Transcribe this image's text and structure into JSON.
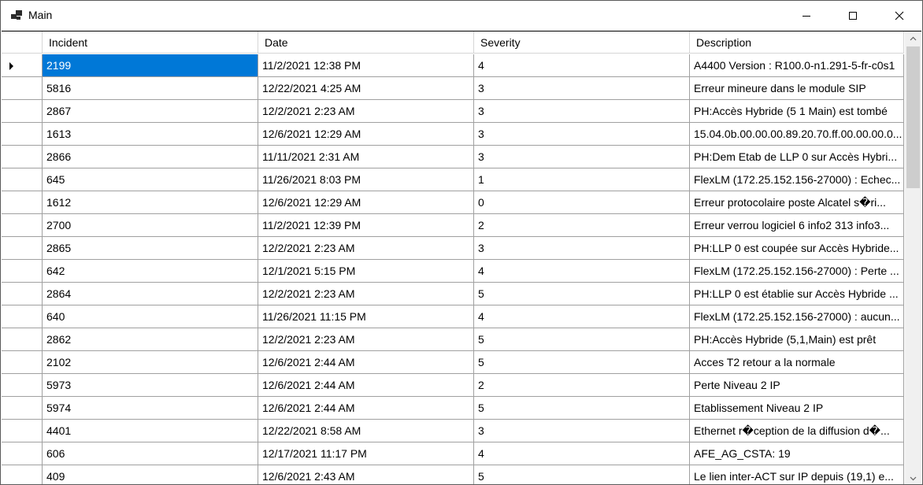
{
  "window": {
    "title": "Main"
  },
  "grid": {
    "columns": [
      "Incident",
      "Date",
      "Severity",
      "Description"
    ],
    "selected_row": 0,
    "selected_col": 0,
    "rows": [
      [
        "2199",
        "11/2/2021 12:38 PM",
        "4",
        "A4400 Version : R100.0-n1.291-5-fr-c0s1"
      ],
      [
        "5816",
        "12/22/2021 4:25 AM",
        "3",
        "Erreur mineure dans le module SIP"
      ],
      [
        "2867",
        "12/2/2021 2:23 AM",
        "3",
        "PH:Accès Hybride (5 1 Main) est tombé"
      ],
      [
        "1613",
        "12/6/2021 12:29 AM",
        "3",
        "15.04.0b.00.00.00.89.20.70.ff.00.00.00.0..."
      ],
      [
        "2866",
        "11/11/2021 2:31 AM",
        "3",
        "PH:Dem Etab de LLP 0 sur Accès Hybri..."
      ],
      [
        "645",
        "11/26/2021 8:03 PM",
        "1",
        "FlexLM (172.25.152.156-27000) : Echec..."
      ],
      [
        "1612",
        "12/6/2021 12:29 AM",
        "0",
        "Erreur protocolaire poste Alcatel s�ri..."
      ],
      [
        "2700",
        "11/2/2021 12:39 PM",
        "2",
        "Erreur verrou logiciel 6 info2 313 info3..."
      ],
      [
        "2865",
        "12/2/2021 2:23 AM",
        "3",
        "PH:LLP 0 est coupée sur Accès Hybride..."
      ],
      [
        "642",
        "12/1/2021 5:15 PM",
        "4",
        "FlexLM (172.25.152.156-27000) : Perte ..."
      ],
      [
        "2864",
        "12/2/2021 2:23 AM",
        "5",
        "PH:LLP 0 est établie sur Accès Hybride ..."
      ],
      [
        "640",
        "11/26/2021 11:15 PM",
        "4",
        "FlexLM (172.25.152.156-27000) : aucun..."
      ],
      [
        "2862",
        "12/2/2021 2:23 AM",
        "5",
        "PH:Accès Hybride (5,1,Main) est prêt"
      ],
      [
        "2102",
        "12/6/2021 2:44 AM",
        "5",
        "Acces T2 retour a la normale"
      ],
      [
        "5973",
        "12/6/2021 2:44 AM",
        "2",
        "Perte Niveau 2 IP"
      ],
      [
        "5974",
        "12/6/2021 2:44 AM",
        "5",
        "Etablissement Niveau 2 IP"
      ],
      [
        "4401",
        "12/22/2021 8:58 AM",
        "3",
        "Ethernet r�ception de la diffusion d�..."
      ],
      [
        "606",
        "12/17/2021 11:17 PM",
        "4",
        "AFE_AG_CSTA: 19"
      ],
      [
        "409",
        "12/6/2021 2:43 AM",
        "5",
        "Le lien inter-ACT sur IP depuis (19,1) e..."
      ]
    ]
  },
  "colors": {
    "selection": "#0078d7",
    "grid_line": "#a0a0a0",
    "scrollbar_track": "#f0f0f0",
    "scrollbar_thumb": "#cdcdcd"
  },
  "icons": {
    "app": "windows-app-icon",
    "minimize": "minimize-icon",
    "maximize": "maximize-icon",
    "close": "close-icon",
    "row_pointer": "current-row-arrow-icon",
    "scroll_up": "scroll-up-arrow-icon",
    "scroll_down": "scroll-down-arrow-icon"
  }
}
